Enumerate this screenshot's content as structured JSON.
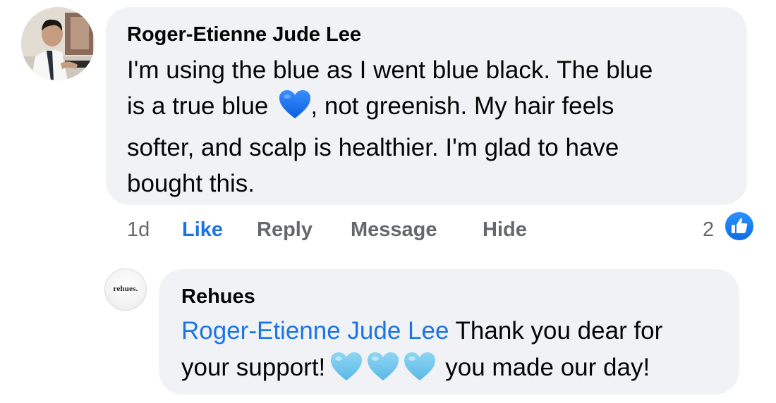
{
  "comment": {
    "author": "Roger-Etienne Jude Lee",
    "lines": [
      "I'm using the blue as I went blue black.  The blue",
      "is a true blue",
      ",  not greenish.  My hair feels",
      "softer,  and scalp is healthier.  I'm glad to have",
      "bought this."
    ],
    "emoji": "blue-heart",
    "heart_color": "#1877f2"
  },
  "actions": {
    "time": "1d",
    "like": "Like",
    "reply": "Reply",
    "message": "Message",
    "hide": "Hide",
    "reaction_count": "2",
    "reaction_icon": "thumbs-up-icon",
    "like_color": "#1b74e4"
  },
  "reply": {
    "author": "Rehues",
    "avatar_text": "rehues.",
    "mention": "Roger-Etienne Jude Lee",
    "text_a": " Thank you dear for",
    "text_b": "your support!",
    "text_c": "you made our day!",
    "emoji": "light-blue-heart",
    "emoji_count": 3,
    "heart_color": "#73c7ec"
  }
}
